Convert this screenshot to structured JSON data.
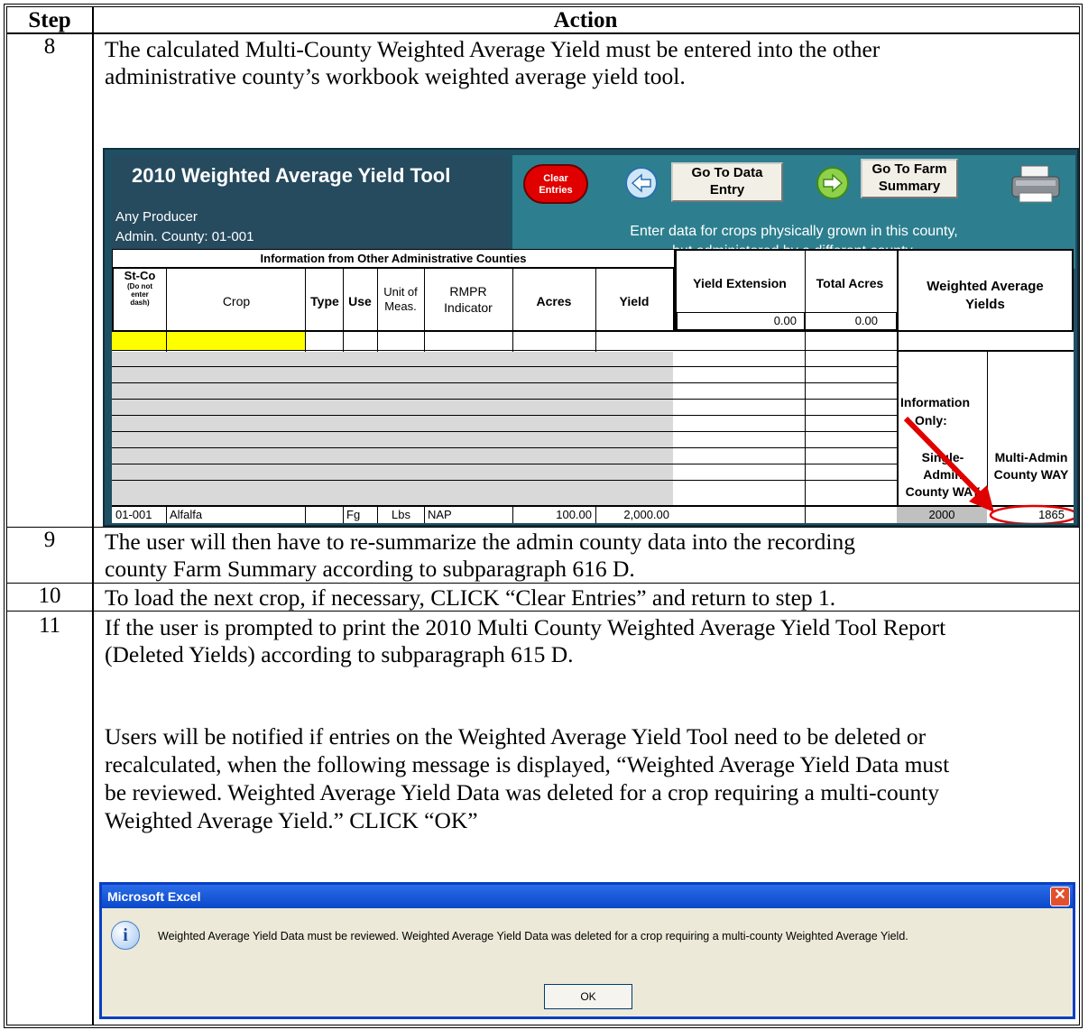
{
  "table_headers": {
    "step": "Step",
    "action": "Action"
  },
  "steps": [
    {
      "num": "8",
      "lines": [
        "The calculated Multi-County Weighted Average Yield must be entered into the other",
        "administrative county’s workbook weighted average yield tool."
      ]
    },
    {
      "num": "9",
      "lines": [
        "The user will then have to re-summarize the admin county data into the recording",
        "county Farm Summary according to subparagraph 616 D."
      ]
    },
    {
      "num": "10",
      "lines": [
        "To load the next crop, if necessary, CLICK “Clear Entries” and return to step 1."
      ]
    },
    {
      "num": "11",
      "lines": [
        "If the user is prompted to print the 2010 Multi County Weighted Average Yield Tool Report",
        "(Deleted Yields) according to subparagraph 615 D."
      ],
      "para2": [
        "Users will be notified if entries on the Weighted Average Yield Tool need to be deleted or",
        "recalculated, when the following message is displayed, “Weighted Average Yield Data must",
        "be reviewed.  Weighted Average Yield Data was deleted for a crop requiring a multi-county",
        "Weighted Average Yield.”  CLICK “OK”"
      ]
    }
  ],
  "tool": {
    "title": "2010 Weighted Average Yield Tool",
    "producer": "Any Producer",
    "county": "Admin. County:  01-001",
    "clear_btn": [
      "Clear",
      "Entries"
    ],
    "goto_data": [
      "Go To Data",
      "Entry"
    ],
    "goto_farm": [
      "Go To Farm",
      "Summary"
    ],
    "enter_text": [
      "Enter data for crops physically grown in this county,",
      "but administered by a different county."
    ],
    "info_header": "Information from Other Administrative Counties",
    "columns": {
      "stco": "St-Co",
      "stco_note": [
        "(Do not",
        "enter",
        "dash)"
      ],
      "crop": "Crop",
      "type": "Type",
      "use": "Use",
      "unit": [
        "Unit of",
        "Meas."
      ],
      "rmpr": [
        "RMPR",
        "Indicator"
      ],
      "acres": "Acres",
      "yield": "Yield",
      "yext": "Yield Extension",
      "tacres": "Total Acres",
      "way": [
        "Weighted Average",
        "Yields"
      ]
    },
    "yext_total": "0.00",
    "tacres_total": "0.00",
    "info_only": [
      "Information",
      "Only:"
    ],
    "single_admin": [
      "Single-",
      "Admin",
      "County WAY"
    ],
    "multi_admin": [
      "Multi-Admin",
      "County WAY"
    ],
    "data_row": {
      "stco": "01-001",
      "crop": "Alfalfa",
      "type": "",
      "use": "Fg",
      "unit": "Lbs",
      "rmpr": "NAP",
      "acres": "100.00",
      "yield": "2,000.00",
      "single": "2000",
      "multi": "1865"
    }
  },
  "dialog": {
    "title": "Microsoft Excel",
    "message": "Weighted Average Yield Data must be reviewed.  Weighted Average Yield Data was deleted for a crop requiring a multi-county Weighted Average Yield.",
    "ok": "OK"
  },
  "colors": {
    "tool_bg": "#1f4f63",
    "teal": "#2d7f8f",
    "red": "#e00000",
    "highlight_yellow": "#ffff00",
    "gray_cell": "#d9d9d9",
    "dialog_title": "#0a48c9"
  }
}
